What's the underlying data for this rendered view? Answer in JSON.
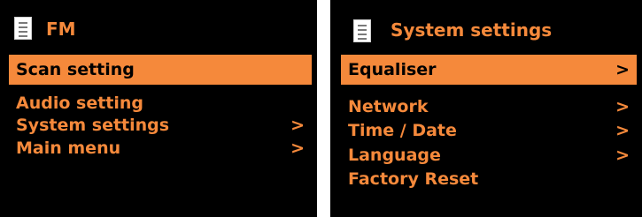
{
  "colors": {
    "background": "#000000",
    "accent": "#f5893b",
    "text_orange": "#f5893b",
    "text_on_selection": "#000000",
    "icon": "#ffffff"
  },
  "fm_screen": {
    "icon": "list-document-icon",
    "title": "FM",
    "items": [
      {
        "label": "Scan setting",
        "arrow": "",
        "selected": true
      },
      {
        "label": "Audio setting",
        "arrow": "",
        "selected": false
      },
      {
        "label": "System settings",
        "arrow": ">",
        "selected": false
      },
      {
        "label": "Main menu",
        "arrow": ">",
        "selected": false
      }
    ]
  },
  "system_screen": {
    "icon": "list-document-icon",
    "title": "System settings",
    "items": [
      {
        "label": "Equaliser",
        "arrow": ">",
        "selected": true
      },
      {
        "label": "Network",
        "arrow": ">",
        "selected": false
      },
      {
        "label": "Time / Date",
        "arrow": ">",
        "selected": false
      },
      {
        "label": "Language",
        "arrow": ">",
        "selected": false
      },
      {
        "label": "Factory Reset",
        "arrow": "",
        "selected": false
      }
    ]
  }
}
